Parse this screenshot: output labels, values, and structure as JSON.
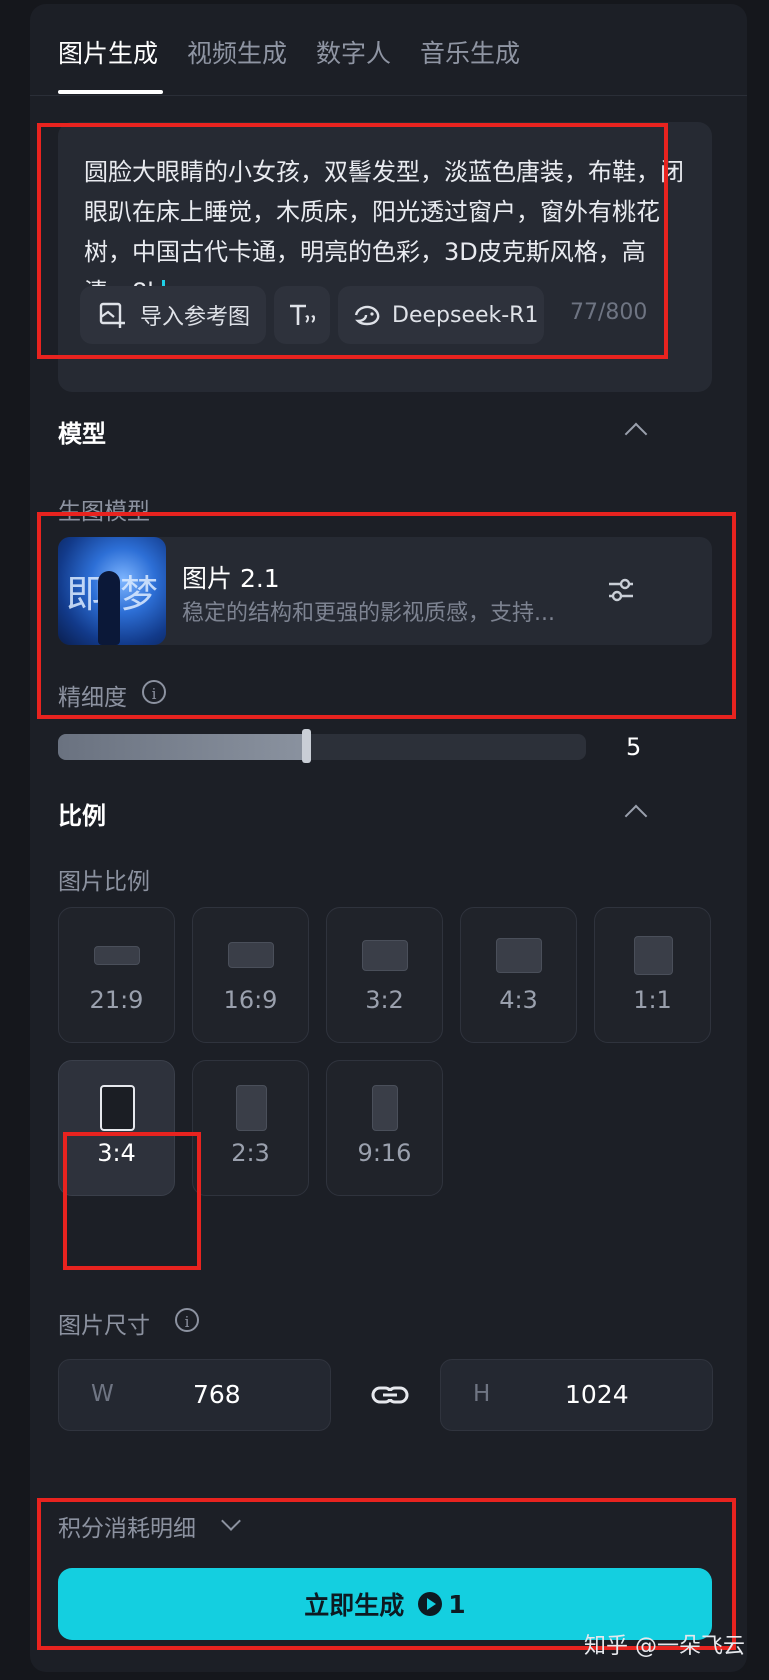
{
  "tabs": [
    {
      "label": "图片生成",
      "active": true
    },
    {
      "label": "视频生成",
      "active": false
    },
    {
      "label": "数字人",
      "active": false
    },
    {
      "label": "音乐生成",
      "active": false
    }
  ],
  "prompt": {
    "text": "圆脸大眼睛的小女孩，双髻发型，淡蓝色唐装，布鞋，闭眼趴在床上睡觉，木质床，阳光透过窗户，窗外有桃花树，中国古代卡通，明亮的色彩，3D皮克斯风格，高清，8k",
    "import_ref_label": "导入参考图",
    "text_style_icon": "text-style-icon",
    "deepseek_label": "Deepseek-R1",
    "counter": "77/800"
  },
  "model_section": {
    "title": "模型",
    "sub_label": "生图模型",
    "thumb_chars": [
      "即",
      "梦"
    ],
    "model_name": "图片 2.1",
    "model_desc": "稳定的结构和更强的影视质感，支持...",
    "settings_icon": "sliders-icon"
  },
  "detail": {
    "label": "精细度",
    "value": "5",
    "fill_fraction": 0.47
  },
  "ratio_section": {
    "title": "比例",
    "sub_label": "图片比例",
    "options": [
      "21:9",
      "16:9",
      "3:2",
      "4:3",
      "1:1",
      "3:4",
      "2:3",
      "9:16"
    ],
    "selected": "3:4"
  },
  "size": {
    "label": "图片尺寸",
    "w_prefix": "W",
    "w_value": "768",
    "h_prefix": "H",
    "h_value": "1024"
  },
  "cost": {
    "label": "积分消耗明细"
  },
  "generate": {
    "label": "立即生成",
    "cost": "1"
  },
  "watermark": "知乎 @一朵飞云",
  "colors": {
    "accent": "#14cfe0",
    "annotation": "#e8231f",
    "panel": "#1c1f26"
  }
}
